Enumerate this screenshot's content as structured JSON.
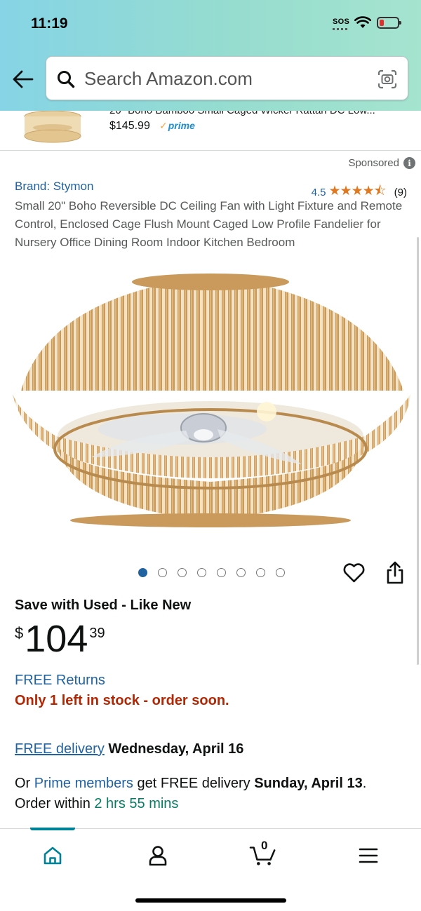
{
  "status_bar": {
    "time": "11:19",
    "sos": "SOS"
  },
  "search": {
    "placeholder": "Search Amazon.com"
  },
  "previous_item": {
    "title": "20\" Boho Bamboo Small Caged Wicker Rattan DC Low...",
    "price": "$145.99",
    "prime_label": "prime"
  },
  "sponsored_label": "Sponsored",
  "product": {
    "brand": "Brand: Stymon",
    "rating": "4.5",
    "stars": "★★★★⯪",
    "rating_count": "(9)",
    "title": "Small 20\" Boho Reversible DC Ceiling Fan with Light Fixture and Remote Control, Enclosed Cage Flush Mount Caged Low Profile Fandelier for Nursery Office Dining Room Indoor Kitchen Bedroom",
    "image_count": 8,
    "active_image": 1
  },
  "offer": {
    "heading": "Save with Used - Like New",
    "price_symbol": "$",
    "price_whole": "104",
    "price_fraction": "39",
    "returns": "FREE Returns",
    "stock": "Only 1 left in stock - order soon."
  },
  "delivery": {
    "link": "FREE delivery",
    "date": "Wednesday, April 16",
    "prime_prefix": "Or",
    "prime_link": "Prime members",
    "prime_mid": "get FREE delivery",
    "prime_date": "Sunday, April 13",
    "prime_end": ".",
    "order_within": "Order within",
    "countdown": "2 hrs 55 mins"
  },
  "bottom_nav": {
    "items": [
      "home-icon",
      "account-icon",
      "cart-icon",
      "menu-icon"
    ],
    "cart_count": "0",
    "accent_color": "#008296"
  },
  "colors": {
    "link": "#2162a1",
    "stock_warning": "#b12704",
    "countdown": "#067d62",
    "stars": "#de7921"
  }
}
